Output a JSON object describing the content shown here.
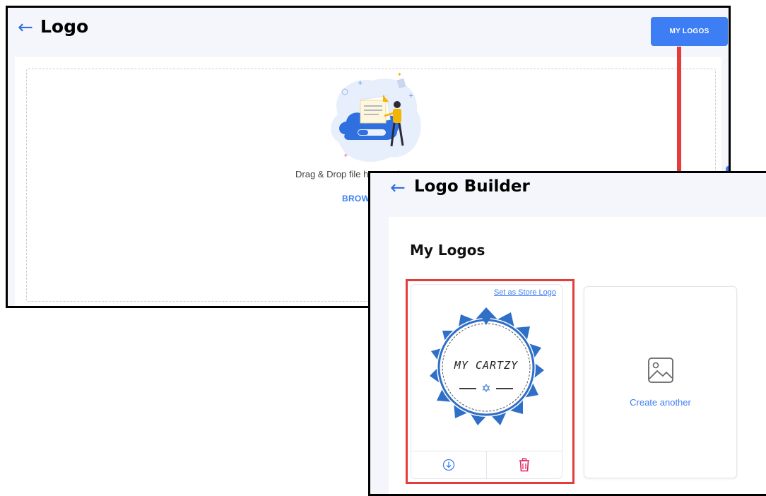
{
  "logo_page": {
    "back_icon": "arrow-left-icon",
    "title": "Logo",
    "my_logos_button": "MY LOGOS",
    "drag_text": "Drag & Drop file h…   …ad",
    "browse_label": "BROW",
    "illustration": "upload-cloud-illustration"
  },
  "annotation": {
    "arrow_color": "#e53b3b",
    "highlight_color": "#e53b3b"
  },
  "builder_page": {
    "back_icon": "arrow-left-icon",
    "title": "Logo Builder",
    "section_title": "My Logos",
    "logo_card": {
      "set_store_link": "Set as Store Logo",
      "badge_text": "MY CARTZY",
      "download_icon": "download-icon",
      "delete_icon": "trash-icon"
    },
    "create_card": {
      "icon": "image-icon",
      "label": "Create another"
    }
  },
  "colors": {
    "accent": "#3d7ef5",
    "badge_blue": "#2f6fc8",
    "delete_red": "#e0245e"
  }
}
